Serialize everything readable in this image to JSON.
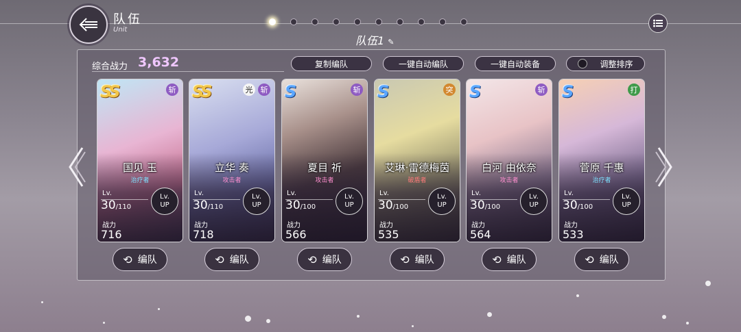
{
  "header": {
    "title": "队伍",
    "subtitle": "Unit",
    "team_label": "队伍1"
  },
  "pager": {
    "count": 10,
    "active": 0
  },
  "summary": {
    "power_label": "综合战力",
    "power_value": "3,632"
  },
  "actions": {
    "copy": "复制编队",
    "auto_form": "一键自动编队",
    "auto_equip": "一键自动装备",
    "sort": "调整排序"
  },
  "cards": [
    {
      "rank": "SS",
      "attrs": [
        "斩"
      ],
      "name": "国见 玉",
      "role": "治疗者",
      "lv": "30",
      "lv_max": "/110",
      "power_label": "战力",
      "power": "716",
      "lv_label": "Lv."
    },
    {
      "rank": "SS",
      "attrs": [
        "光",
        "斩"
      ],
      "name": "立华 奏",
      "role": "攻击者",
      "lv": "30",
      "lv_max": "/110",
      "power_label": "战力",
      "power": "718",
      "lv_label": "Lv."
    },
    {
      "rank": "S",
      "attrs": [
        "斩"
      ],
      "name": "夏目 祈",
      "role": "攻击者",
      "lv": "30",
      "lv_max": "/100",
      "power_label": "战力",
      "power": "566",
      "lv_label": "Lv."
    },
    {
      "rank": "S",
      "attrs": [
        "突"
      ],
      "name": "艾琳·雷德梅茵",
      "role": "破盾者",
      "lv": "30",
      "lv_max": "/100",
      "power_label": "战力",
      "power": "535",
      "lv_label": "Lv."
    },
    {
      "rank": "S",
      "attrs": [
        "斩"
      ],
      "name": "白河 由依奈",
      "role": "攻击者",
      "lv": "30",
      "lv_max": "/100",
      "power_label": "战力",
      "power": "564",
      "lv_label": "Lv."
    },
    {
      "rank": "S",
      "attrs": [
        "打"
      ],
      "name": "菅原 千惠",
      "role": "治疗者",
      "lv": "30",
      "lv_max": "/100",
      "power_label": "战力",
      "power": "533",
      "lv_label": "Lv."
    }
  ],
  "lvup": {
    "top": "Lv.",
    "bottom": "UP"
  },
  "form_button": "编队",
  "colors": {
    "attr_slash": "#8e5bc2",
    "attr_light": "#f5f5f5",
    "attr_thrust": "#d2882e",
    "attr_blunt": "#3f9a4a",
    "role_healer": "#7de1ff",
    "role_attacker": "#ff8fd0",
    "role_breaker": "#ff7a7a",
    "power_accent": "#f0c7ff"
  },
  "icons": {
    "back": "arrow-left-icon",
    "menu": "list-menu-icon",
    "edit": "pencil-icon",
    "swap": "swap-cycle-icon",
    "prev": "chevron-left-icon",
    "next": "chevron-right-icon"
  }
}
